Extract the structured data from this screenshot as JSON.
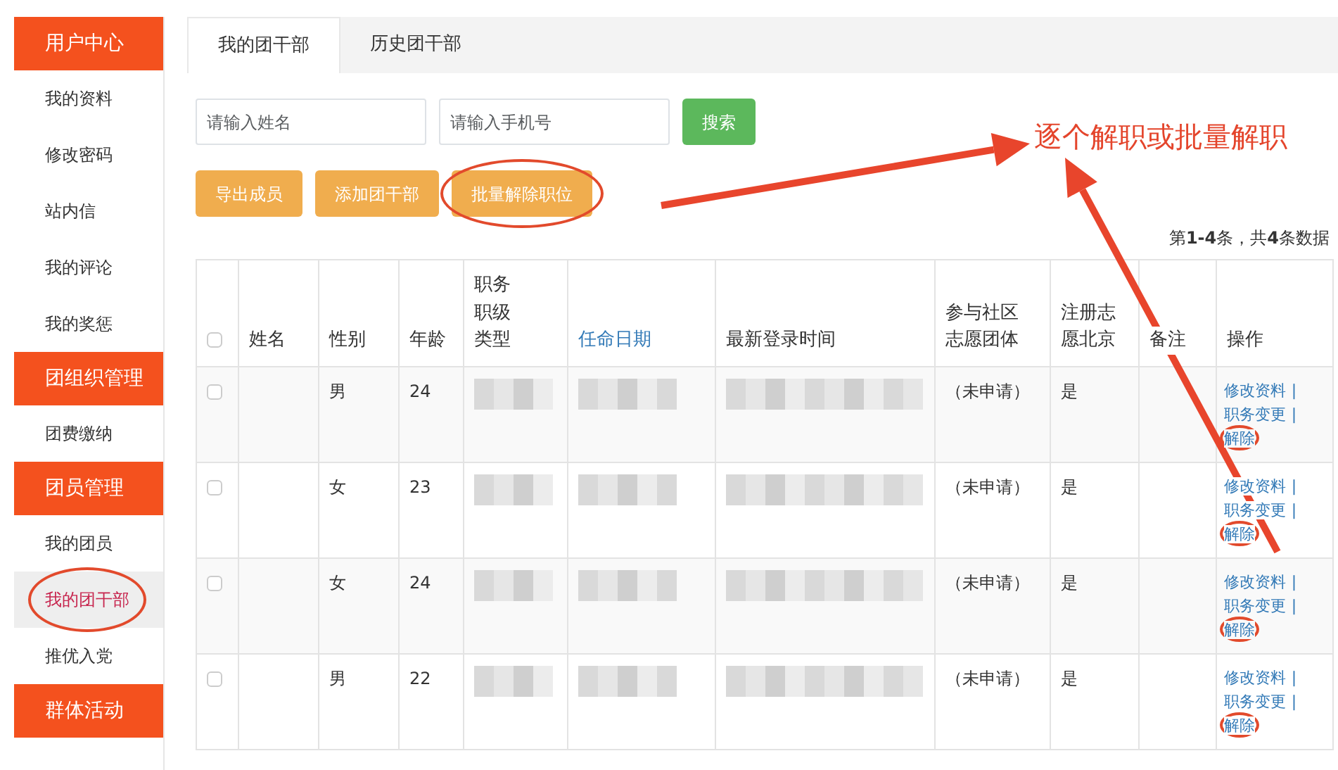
{
  "sidebar": {
    "sections": [
      {
        "title": "用户中心",
        "items": [
          {
            "label": "我的资料",
            "selected": false,
            "circled": false
          },
          {
            "label": "修改密码",
            "selected": false,
            "circled": false
          },
          {
            "label": "站内信",
            "selected": false,
            "circled": false
          },
          {
            "label": "我的评论",
            "selected": false,
            "circled": false
          },
          {
            "label": "我的奖惩",
            "selected": false,
            "circled": false
          }
        ]
      },
      {
        "title": "团组织管理",
        "items": [
          {
            "label": "团费缴纳",
            "selected": false,
            "circled": false
          }
        ]
      },
      {
        "title": "团员管理",
        "items": [
          {
            "label": "我的团员",
            "selected": false,
            "circled": false
          },
          {
            "label": "我的团干部",
            "selected": true,
            "circled": true
          },
          {
            "label": "推优入党",
            "selected": false,
            "circled": false
          }
        ]
      },
      {
        "title": "群体活动"
      }
    ]
  },
  "tabs": [
    {
      "label": "我的团干部",
      "selected": true
    },
    {
      "label": "历史团干部",
      "selected": false
    }
  ],
  "search": {
    "name_placeholder": "请输入姓名",
    "phone_placeholder": "请输入手机号",
    "button": "搜索"
  },
  "actions": [
    {
      "label": "导出成员",
      "circled": false
    },
    {
      "label": "添加团干部",
      "circled": false
    },
    {
      "label": "批量解除职位",
      "circled": true
    }
  ],
  "annotation_note": "逐个解职或批量解职",
  "summary": "第**1-4**条，共**4**条数据",
  "table": {
    "header_checked": false,
    "columns": [
      {
        "label": "姓名",
        "sortable": false
      },
      {
        "label": "性别",
        "sortable": false
      },
      {
        "label": "年龄",
        "sortable": false
      },
      {
        "label": "职务职级类型",
        "sortable": false
      },
      {
        "label": "任命日期",
        "sortable": true
      },
      {
        "label": "最新登录时间",
        "sortable": false
      },
      {
        "label": "参与社区志愿团体",
        "sortable": false
      },
      {
        "label": "注册志愿北京",
        "sortable": false
      },
      {
        "label": "备注",
        "sortable": false
      },
      {
        "label": "操作",
        "sortable": false
      }
    ],
    "rows": [
      {
        "checked": false,
        "gender": "男",
        "age": "24",
        "community_group": "（未申请）",
        "registered": "是",
        "actions": [
          {
            "kind": "link",
            "label": "修改资料",
            "circled": false
          },
          {
            "kind": "separator",
            "label": "|"
          },
          {
            "kind": "link",
            "label": "职务变更",
            "circled": false
          },
          {
            "kind": "separator",
            "label": "|"
          },
          {
            "kind": "link",
            "label": "解除",
            "circled": true
          }
        ]
      },
      {
        "checked": false,
        "gender": "女",
        "age": "23",
        "community_group": "（未申请）",
        "registered": "是",
        "actions": [
          {
            "kind": "link",
            "label": "修改资料",
            "circled": false
          },
          {
            "kind": "separator",
            "label": "|"
          },
          {
            "kind": "link",
            "label": "职务变更",
            "circled": false
          },
          {
            "kind": "separator",
            "label": "|"
          },
          {
            "kind": "link",
            "label": "解除",
            "circled": true
          }
        ]
      },
      {
        "checked": false,
        "gender": "女",
        "age": "24",
        "community_group": "（未申请）",
        "registered": "是",
        "actions": [
          {
            "kind": "link",
            "label": "修改资料",
            "circled": false
          },
          {
            "kind": "separator",
            "label": "|"
          },
          {
            "kind": "link",
            "label": "职务变更",
            "circled": false
          },
          {
            "kind": "separator",
            "label": "|"
          },
          {
            "kind": "link",
            "label": "解除",
            "circled": true
          }
        ]
      },
      {
        "checked": false,
        "gender": "男",
        "age": "22",
        "community_group": "（未申请）",
        "registered": "是",
        "actions": [
          {
            "kind": "link",
            "label": "修改资料",
            "circled": false
          },
          {
            "kind": "separator",
            "label": "|"
          },
          {
            "kind": "link",
            "label": "职务变更",
            "circled": false
          },
          {
            "kind": "separator",
            "label": "|"
          },
          {
            "kind": "link",
            "label": "解除",
            "circled": true
          }
        ]
      }
    ]
  }
}
